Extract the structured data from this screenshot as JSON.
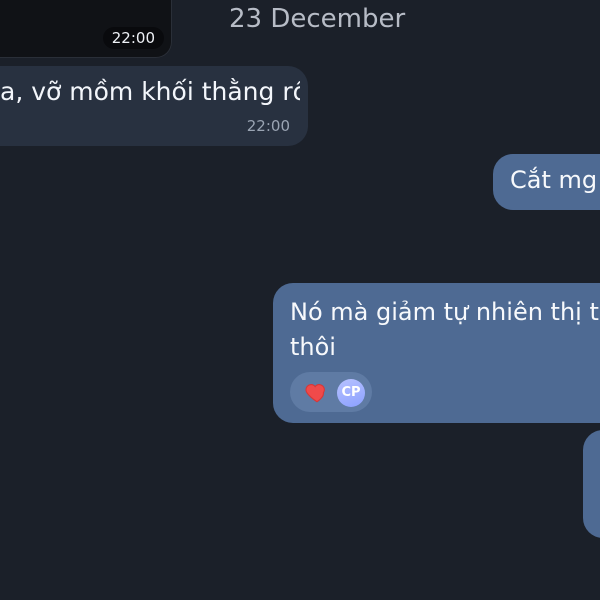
{
  "conversation": {
    "date_separator": "23 December",
    "media_message": {
      "time": "22:00"
    },
    "incoming_message": {
      "text": "a, vỡ mồm khối thằng rồi",
      "time": "22:00"
    },
    "outgoing_messages": [
      {
        "text": "Cắt mg"
      },
      {
        "text_line_1": "Nó mà giảm tự nhiên thị tr",
        "text_line_2": "thôi",
        "reactions": {
          "icon": "heart-icon",
          "avatar_label": "CP"
        }
      }
    ]
  },
  "colors": {
    "background": "#1b2029",
    "incoming_bubble": "#283140",
    "outgoing_bubble": "#4e6a93",
    "accent": "#8ba0ff"
  }
}
